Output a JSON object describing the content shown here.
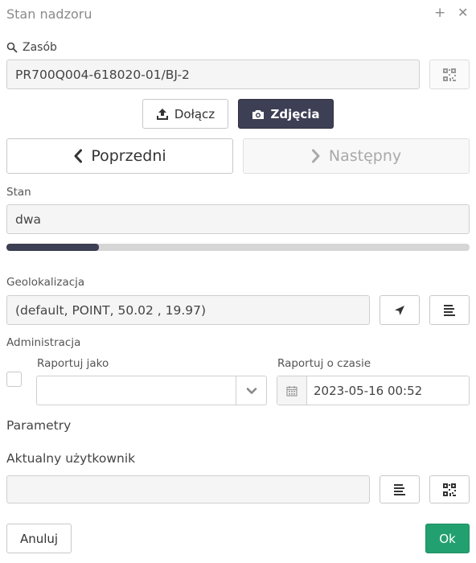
{
  "dialog": {
    "title": "Stan nadzoru"
  },
  "asset": {
    "label": "Zasób",
    "value": "PR700Q004-618020-01/BJ-2"
  },
  "actions": {
    "attach_label": "Dołącz",
    "photos_label": "Zdjęcia"
  },
  "nav": {
    "prev_label": "Poprzedni",
    "next_label": "Następny"
  },
  "state": {
    "label": "Stan",
    "value": "dwa",
    "progress": 0.2
  },
  "geo": {
    "label": "Geolokalizacja",
    "value": "(default, POINT, 50.02 , 19.97)"
  },
  "admin": {
    "label": "Administracja",
    "report_as_label": "Raportuj jako",
    "report_as_value": "",
    "report_time_label": "Raportuj o czasie",
    "report_time_value": "2023-05-16 00:52"
  },
  "params": {
    "label": "Parametry"
  },
  "current_user": {
    "label": "Aktualny użytkownik",
    "value": ""
  },
  "footer": {
    "cancel_label": "Anuluj",
    "ok_label": "Ok"
  },
  "colors": {
    "accent_dark": "#3d3f54",
    "ok_green": "#23a06f"
  }
}
